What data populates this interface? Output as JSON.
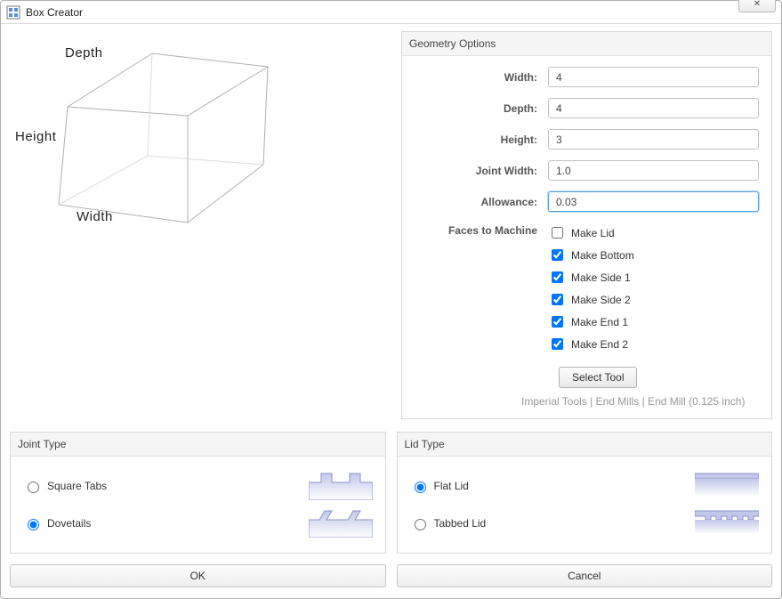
{
  "window": {
    "title": "Box Creator",
    "close_symbol": "✕"
  },
  "diagram": {
    "depth_label": "Depth",
    "height_label": "Height",
    "width_label": "Width"
  },
  "geometry": {
    "header": "Geometry Options",
    "width_label": "Width:",
    "width_value": "4",
    "depth_label": "Depth:",
    "depth_value": "4",
    "height_label": "Height:",
    "height_value": "3",
    "joint_width_label": "Joint Width:",
    "joint_width_value": "1.0",
    "allowance_label": "Allowance:",
    "allowance_value": "0.03",
    "faces_label": "Faces to Machine",
    "faces": [
      {
        "label": "Make Lid",
        "checked": false
      },
      {
        "label": "Make Bottom",
        "checked": true
      },
      {
        "label": "Make Side 1",
        "checked": true
      },
      {
        "label": "Make Side 2",
        "checked": true
      },
      {
        "label": "Make End 1",
        "checked": true
      },
      {
        "label": "Make End 2",
        "checked": true
      }
    ],
    "select_tool_label": "Select Tool",
    "tool_desc": "Imperial Tools | End Mills | End Mill (0.125 inch)"
  },
  "joint_type": {
    "header": "Joint Type",
    "options": [
      {
        "label": "Square Tabs",
        "selected": false
      },
      {
        "label": "Dovetails",
        "selected": true
      }
    ]
  },
  "lid_type": {
    "header": "Lid Type",
    "options": [
      {
        "label": "Flat Lid",
        "selected": true
      },
      {
        "label": "Tabbed Lid",
        "selected": false
      }
    ]
  },
  "buttons": {
    "ok": "OK",
    "cancel": "Cancel"
  },
  "colors": {
    "illus_fill": "#c2c8ea",
    "illus_stroke": "#8b92c9"
  }
}
